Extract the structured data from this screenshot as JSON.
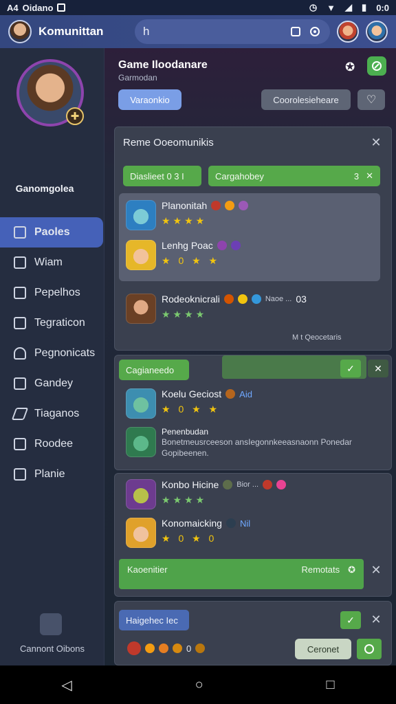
{
  "status_bar": {
    "left_text": "A4",
    "carrier": "Oidano",
    "time": "0:0"
  },
  "app_bar": {
    "title": "Komunittan",
    "search_value": "h"
  },
  "sidebar": {
    "profile_name": "Ganomgolea",
    "items": [
      {
        "label": "Paoles",
        "icon": "edit-icon"
      },
      {
        "label": "Wiam",
        "icon": "list-icon"
      },
      {
        "label": "Pepelhos",
        "icon": "search-icon"
      },
      {
        "label": "Tegraticon",
        "icon": "bookmark-icon"
      },
      {
        "label": "Pegnonicats",
        "icon": "people-icon"
      },
      {
        "label": "Gandey",
        "icon": "square-icon"
      },
      {
        "label": "Tiaganos",
        "icon": "pen-icon"
      },
      {
        "label": "Roodee",
        "icon": "image-icon"
      },
      {
        "label": "Planie",
        "icon": "frame-icon"
      }
    ],
    "footer_label": "Cannont Oibons"
  },
  "header": {
    "title": "Game Iloodanare",
    "subtitle": "Garmodan",
    "primary_button": "Varaonkio",
    "secondary_button": "Coorolesieheare"
  },
  "card1": {
    "title": "Reme Ooeomunikis",
    "filter_left": "Diaslieet 0 3 I",
    "filter_right": "Cargahobey",
    "filter_right_count": "3",
    "rows": [
      {
        "name": "Planonitah",
        "stars": "★★★★"
      },
      {
        "name": "Lenhg Poac",
        "stars": "★ 0 ★ ★"
      },
      {
        "name": "Rodeoknicrali",
        "extra": "Naoe ...",
        "count": "03",
        "stars": "★★★★"
      }
    ],
    "footer_text": "M  t   Qeocetaris"
  },
  "card2": {
    "pill": "Cagianeedo",
    "rows": [
      {
        "name": "Koelu Geciost",
        "tag": "Aid",
        "stars": "★ 0 ★ ★"
      },
      {
        "name": "Penenbudan",
        "desc": "Bonetmeusrceeson ansIegonnkeeasnaonn Ponedar Gopibeenen.",
        "stars": ""
      }
    ]
  },
  "card3": {
    "rows": [
      {
        "name": "Konbo Hicine",
        "extra": "Bior ...",
        "stars": "★★★★"
      },
      {
        "name": "Konomaicking",
        "tag": "Nil",
        "stars": "★ 0 ★ 0"
      }
    ],
    "bar_left": "Kaoenitier",
    "bar_right": "Remotats"
  },
  "card4": {
    "pill": "Haigehec Iec",
    "button": "Ceronet",
    "chips_text": "0"
  },
  "colors": {
    "accent_blue": "#4561b8",
    "accent_green": "#56a94a",
    "panel": "#3a404f"
  }
}
